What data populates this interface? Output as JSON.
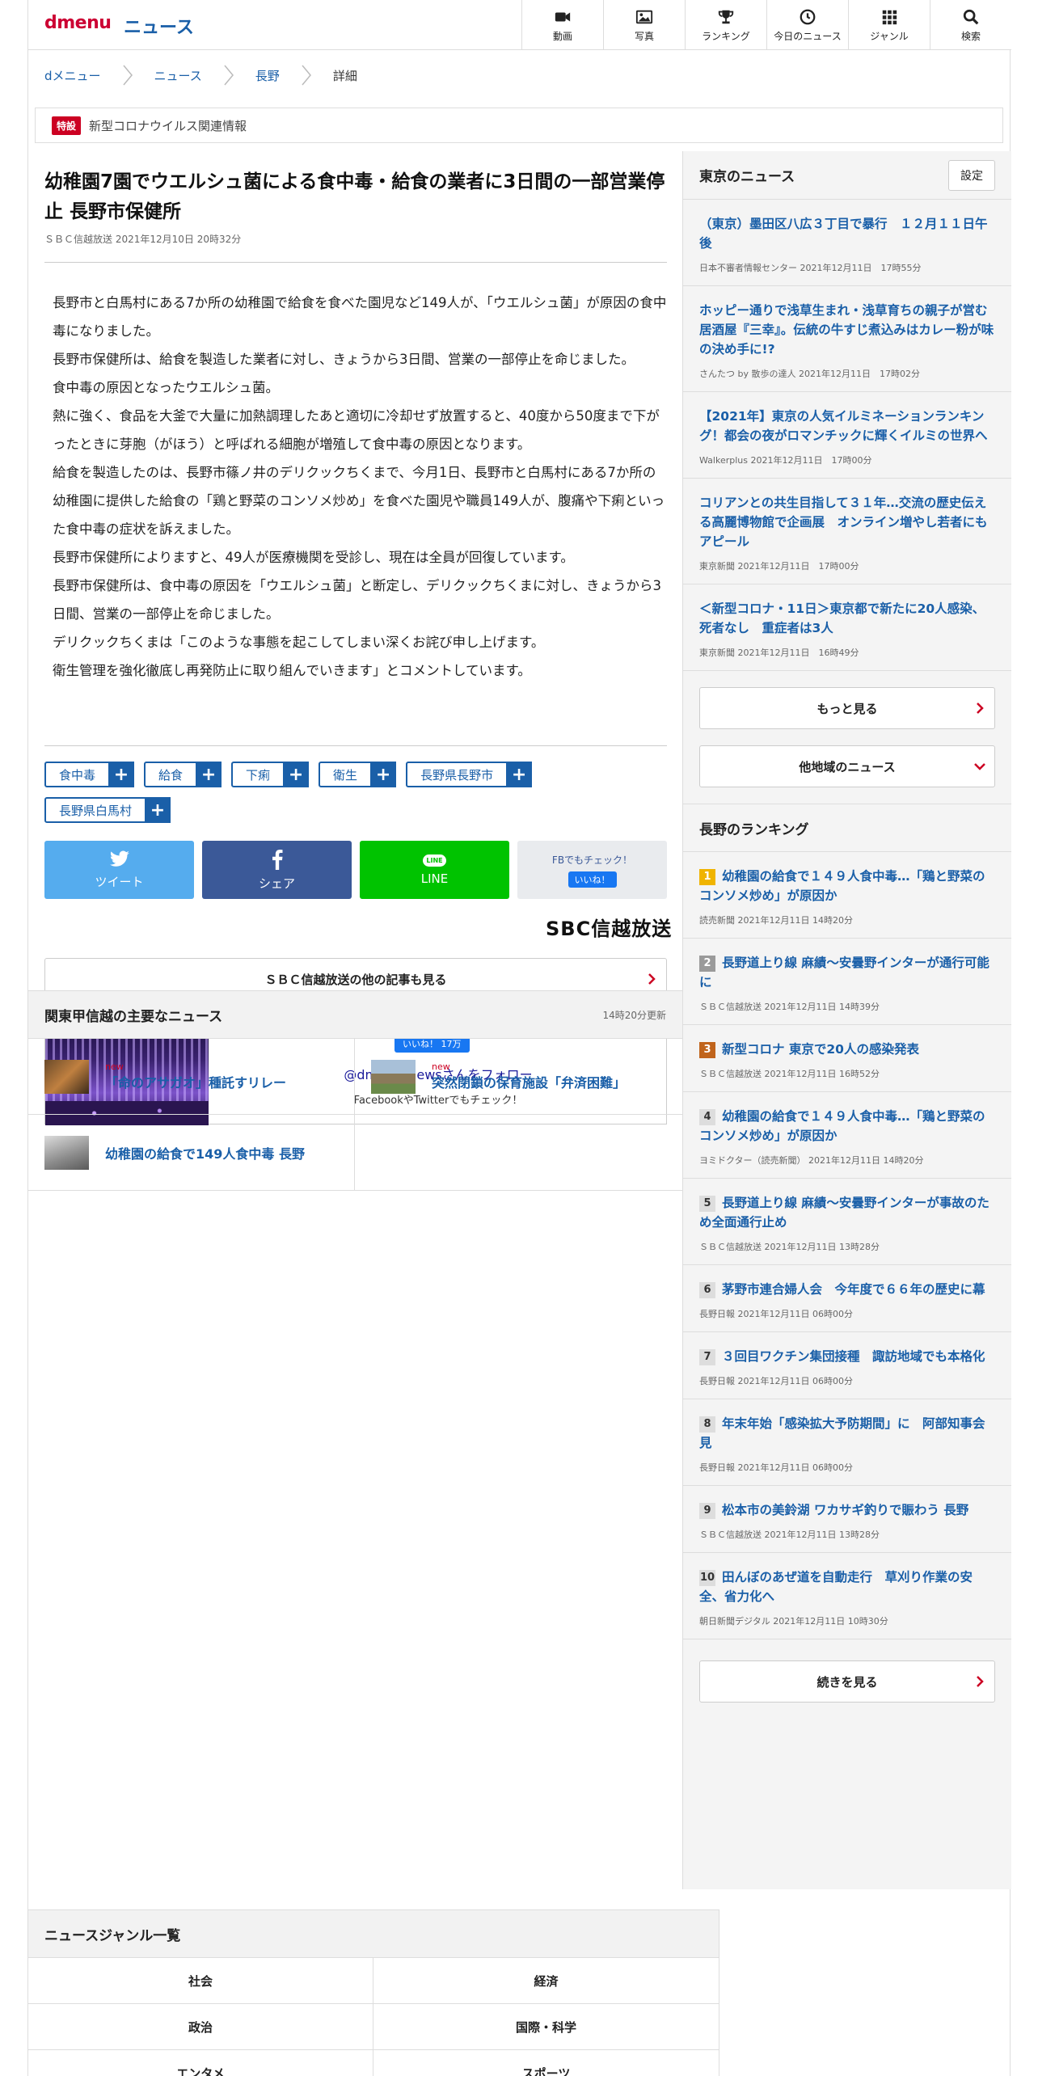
{
  "header": {
    "logo": "dmenu",
    "section": "ニュース",
    "nav": [
      {
        "label": "動画",
        "icon": "video-camera-icon"
      },
      {
        "label": "写真",
        "icon": "photo-icon"
      },
      {
        "label": "ランキング",
        "icon": "trophy-icon"
      },
      {
        "label": "今日のニュース",
        "icon": "clock-icon"
      },
      {
        "label": "ジャンル",
        "icon": "grid-icon"
      },
      {
        "label": "検索",
        "icon": "search-icon"
      }
    ]
  },
  "breadcrumb": [
    "dメニュー",
    "ニュース",
    "長野",
    "詳細"
  ],
  "special": {
    "tag": "特設",
    "text": "新型コロナウイルス関連情報"
  },
  "article": {
    "title": "幼稚園7園でウエルシュ菌による食中毒・給食の業者に3日間の一部営業停止 長野市保健所",
    "meta": "ＳＢＣ信越放送 2021年12月10日 20時32分",
    "paragraphs": [
      "長野市と白馬村にある7か所の幼稚園で給食を食べた園児など149人が、「ウエルシュ菌」が原因の食中毒になりました。",
      "長野市保健所は、給食を製造した業者に対し、きょうから3日間、営業の一部停止を命じました。",
      "食中毒の原因となったウエルシュ菌。",
      "熱に強く、食品を大釜で大量に加熱調理したあと適切に冷却せず放置すると、40度から50度まで下がったときに芽胞（がほう）と呼ばれる細胞が増殖して食中毒の原因となります。",
      "給食を製造したのは、長野市篠ノ井のデリクックちくまで、今月1日、長野市と白馬村にある7か所の幼稚園に提供した給食の「鶏と野菜のコンソメ炒め」を食べた園児や職員149人が、腹痛や下痢といった食中毒の症状を訴えました。",
      "長野市保健所によりますと、49人が医療機関を受診し、現在は全員が回復しています。",
      "長野市保健所は、食中毒の原因を「ウエルシュ菌」と断定し、デリクックちくまに対し、きょうから3日間、営業の一部停止を命じました。",
      "デリクックちくまは「このような事態を起こしてしまい深くお詫び申し上げます。",
      "衛生管理を強化徹底し再発防止に取り組んでいきます」とコメントしています。"
    ],
    "tags": [
      "食中毒",
      "給食",
      "下痢",
      "衛生",
      "長野県長野市",
      "長野県白馬村"
    ],
    "share": {
      "tweet": "ツイート",
      "share": "シェア",
      "line": "LINE",
      "line_icon": "LINE",
      "fb_check": "FBでもチェック！",
      "fb_like": "いいね！"
    },
    "source_logo": "SBC信越放送",
    "more_from_source": "ＳＢＣ信越放送の他の記事も見る",
    "promo": {
      "like": "いいね！ 17万",
      "follow": "@dmenu_newsさんをフォロー",
      "sub": "FacebookやTwitterでもチェック！"
    }
  },
  "major": {
    "title": "関東甲信越の主要なニュース",
    "updated": "14時20分更新",
    "items": [
      {
        "new": "new",
        "title": "「命のアサガオ」種託すリレー"
      },
      {
        "new": "new",
        "title": "突然閉鎖の保育施設「弁済困難」"
      },
      {
        "new": "",
        "title": "幼稚園の給食で149人食中毒 長野"
      }
    ]
  },
  "tokyo": {
    "title": "東京のニュース",
    "settings": "設定",
    "items": [
      {
        "title": "（東京）墨田区八広３丁目で暴行　１２月１１日午後",
        "meta": "日本不審者情報センター  2021年12月11日　17時55分"
      },
      {
        "title": "ホッピー通りで浅草生まれ・浅草育ちの親子が営む居酒屋『三幸』。伝統の牛すじ煮込みはカレー粉が味の決め手に!?",
        "meta": "さんたつ by 散歩の達人  2021年12月11日　17時02分"
      },
      {
        "title": "【2021年】東京の人気イルミネーションランキング！都会の夜がロマンチックに輝くイルミの世界へ",
        "meta": "Walkerplus  2021年12月11日　17時00分"
      },
      {
        "title": "コリアンとの共生目指して３１年…交流の歴史伝える高麗博物館で企画展　オンライン増やし若者にもアピール",
        "meta": "東京新聞  2021年12月11日　17時00分"
      },
      {
        "title": "＜新型コロナ・11日＞東京都で新たに20人感染、死者なし　重症者は3人",
        "meta": "東京新聞  2021年12月11日　16時49分"
      }
    ],
    "more": "もっと見る",
    "other_regions": "他地域のニュース"
  },
  "ranking": {
    "title": "長野のランキング",
    "items": [
      {
        "rank": "1",
        "title": "幼稚園の給食で１４９人食中毒…「鶏と野菜のコンソメ炒め」が原因か",
        "meta": "読売新聞 2021年12月11日 14時20分"
      },
      {
        "rank": "2",
        "title": "長野道上り線 麻績～安曇野インターが通行可能に",
        "meta": "ＳＢＣ信越放送 2021年12月11日 14時39分"
      },
      {
        "rank": "3",
        "title": "新型コロナ 東京で20人の感染発表",
        "meta": "ＳＢＣ信越放送 2021年12月11日 16時52分"
      },
      {
        "rank": "4",
        "title": "幼稚園の給食で１４９人食中毒…「鶏と野菜のコンソメ炒め」が原因か",
        "meta": "ヨミドクター（読売新聞） 2021年12月11日 14時20分"
      },
      {
        "rank": "5",
        "title": "長野道上り線 麻績～安曇野インターが事故のため全面通行止め",
        "meta": "ＳＢＣ信越放送 2021年12月11日 13時28分"
      },
      {
        "rank": "6",
        "title": "茅野市連合婦人会　今年度で６６年の歴史に幕",
        "meta": "長野日報 2021年12月11日 06時00分"
      },
      {
        "rank": "7",
        "title": "３回目ワクチン集団接種　諏訪地域でも本格化",
        "meta": "長野日報 2021年12月11日 06時00分"
      },
      {
        "rank": "8",
        "title": "年末年始「感染拡大予防期間」に　阿部知事会見",
        "meta": "長野日報 2021年12月11日 06時00分"
      },
      {
        "rank": "9",
        "title": "松本市の美鈴湖 ワカサギ釣りで賑わう 長野",
        "meta": "ＳＢＣ信越放送 2021年12月11日 13時28分"
      },
      {
        "rank": "10",
        "title": "田んぼのあぜ道を自動走行　草刈り作業の安全、省力化へ",
        "meta": "朝日新聞デジタル 2021年12月11日 10時30分"
      }
    ],
    "more": "続きを見る"
  },
  "genre": {
    "title": "ニュースジャンル一覧",
    "items": [
      "社会",
      "経済",
      "政治",
      "国際・科学",
      "エンタメ",
      "スポーツ"
    ]
  },
  "colors": {
    "brand_red": "#cc0033",
    "link_blue": "#1a5fa8",
    "twitter": "#55acee",
    "facebook": "#3b5998",
    "line": "#00c300"
  }
}
